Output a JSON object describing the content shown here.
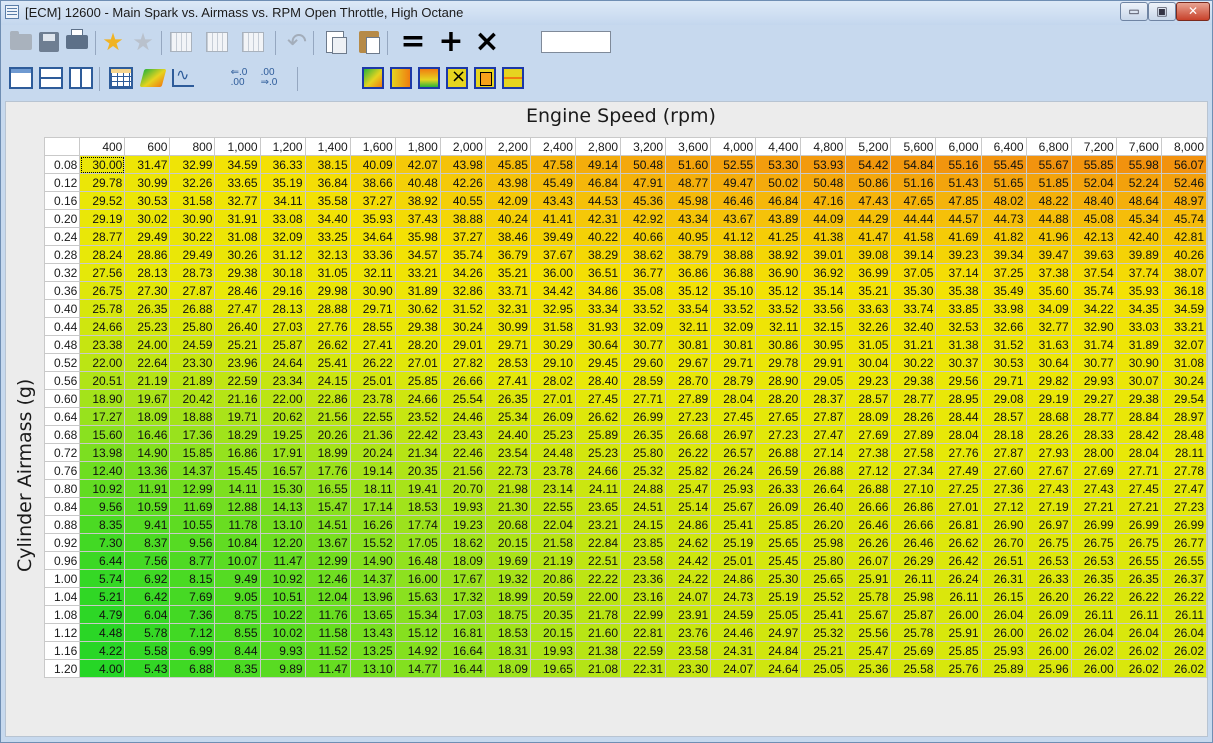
{
  "window": {
    "title": "[ECM] 12600 - Main Spark vs. Airmass vs. RPM Open Throttle, High Octane",
    "controls": {
      "minimize": "▭",
      "maximize": "▣",
      "close": "✕"
    }
  },
  "toolbar": {
    "row1_icons": [
      "open-folder-icon",
      "save-disk-icon",
      "print-icon",
      "add-favorite-star-icon",
      "remove-favorite-star-icon",
      "compare-grid-icon",
      "compare-grid-2-icon",
      "compare-grid-3-icon",
      "undo-icon",
      "copy-icon",
      "paste-icon",
      "set-equal-icon",
      "add-icon",
      "multiply-icon"
    ],
    "row2_icons": [
      "view-table-window-icon",
      "view-split-horizontal-icon",
      "view-split-vertical-icon",
      "table-view-icon",
      "3d-surface-icon",
      "2d-graph-icon",
      "decrease-decimals-icon",
      "increase-decimals-icon",
      "smooth-surface-icon",
      "smooth-columns-icon",
      "smooth-rows-icon",
      "interpolate-icon",
      "fill-selection-icon",
      "interpolate-rows-icon"
    ],
    "operation_value": "",
    "decrease_decimals_label": "⇐.0\n.00",
    "increase_decimals_label": ".00\n⇒.0"
  },
  "table": {
    "col_axis_title": "Engine Speed (rpm)",
    "row_axis_title": "Cylinder Airmass (g)",
    "columns": [
      "400",
      "600",
      "800",
      "1,000",
      "1,200",
      "1,400",
      "1,600",
      "1,800",
      "2,000",
      "2,200",
      "2,400",
      "2,800",
      "3,200",
      "3,600",
      "4,000",
      "4,400",
      "4,800",
      "5,200",
      "5,600",
      "6,000",
      "6,400",
      "6,800",
      "7,200",
      "7,600",
      "8,000"
    ],
    "rows": [
      {
        "airmass": "0.08",
        "values": [
          "30.00",
          "31.47",
          "32.99",
          "34.59",
          "36.33",
          "38.15",
          "40.09",
          "42.07",
          "43.98",
          "45.85",
          "47.58",
          "49.14",
          "50.48",
          "51.60",
          "52.55",
          "53.30",
          "53.93",
          "54.42",
          "54.84",
          "55.16",
          "55.45",
          "55.67",
          "55.85",
          "55.98",
          "56.07"
        ]
      },
      {
        "airmass": "0.12",
        "values": [
          "29.78",
          "30.99",
          "32.26",
          "33.65",
          "35.19",
          "36.84",
          "38.66",
          "40.48",
          "42.26",
          "43.98",
          "45.49",
          "46.84",
          "47.91",
          "48.77",
          "49.47",
          "50.02",
          "50.48",
          "50.86",
          "51.16",
          "51.43",
          "51.65",
          "51.85",
          "52.04",
          "52.24",
          "52.46"
        ]
      },
      {
        "airmass": "0.16",
        "values": [
          "29.52",
          "30.53",
          "31.58",
          "32.77",
          "34.11",
          "35.58",
          "37.27",
          "38.92",
          "40.55",
          "42.09",
          "43.43",
          "44.53",
          "45.36",
          "45.98",
          "46.46",
          "46.84",
          "47.16",
          "47.43",
          "47.65",
          "47.85",
          "48.02",
          "48.22",
          "48.40",
          "48.64",
          "48.97"
        ]
      },
      {
        "airmass": "0.20",
        "values": [
          "29.19",
          "30.02",
          "30.90",
          "31.91",
          "33.08",
          "34.40",
          "35.93",
          "37.43",
          "38.88",
          "40.24",
          "41.41",
          "42.31",
          "42.92",
          "43.34",
          "43.67",
          "43.89",
          "44.09",
          "44.29",
          "44.44",
          "44.57",
          "44.73",
          "44.88",
          "45.08",
          "45.34",
          "45.74"
        ]
      },
      {
        "airmass": "0.24",
        "values": [
          "28.77",
          "29.49",
          "30.22",
          "31.08",
          "32.09",
          "33.25",
          "34.64",
          "35.98",
          "37.27",
          "38.46",
          "39.49",
          "40.22",
          "40.66",
          "40.95",
          "41.12",
          "41.25",
          "41.38",
          "41.47",
          "41.58",
          "41.69",
          "41.82",
          "41.96",
          "42.13",
          "42.40",
          "42.81"
        ]
      },
      {
        "airmass": "0.28",
        "values": [
          "28.24",
          "28.86",
          "29.49",
          "30.26",
          "31.12",
          "32.13",
          "33.36",
          "34.57",
          "35.74",
          "36.79",
          "37.67",
          "38.29",
          "38.62",
          "38.79",
          "38.88",
          "38.92",
          "39.01",
          "39.08",
          "39.14",
          "39.23",
          "39.34",
          "39.47",
          "39.63",
          "39.89",
          "40.26"
        ]
      },
      {
        "airmass": "0.32",
        "values": [
          "27.56",
          "28.13",
          "28.73",
          "29.38",
          "30.18",
          "31.05",
          "32.11",
          "33.21",
          "34.26",
          "35.21",
          "36.00",
          "36.51",
          "36.77",
          "36.86",
          "36.88",
          "36.90",
          "36.92",
          "36.99",
          "37.05",
          "37.14",
          "37.25",
          "37.38",
          "37.54",
          "37.74",
          "38.07"
        ]
      },
      {
        "airmass": "0.36",
        "values": [
          "26.75",
          "27.30",
          "27.87",
          "28.46",
          "29.16",
          "29.98",
          "30.90",
          "31.89",
          "32.86",
          "33.71",
          "34.42",
          "34.86",
          "35.08",
          "35.12",
          "35.10",
          "35.12",
          "35.14",
          "35.21",
          "35.30",
          "35.38",
          "35.49",
          "35.60",
          "35.74",
          "35.93",
          "36.18"
        ]
      },
      {
        "airmass": "0.40",
        "values": [
          "25.78",
          "26.35",
          "26.88",
          "27.47",
          "28.13",
          "28.88",
          "29.71",
          "30.62",
          "31.52",
          "32.31",
          "32.95",
          "33.34",
          "33.52",
          "33.54",
          "33.52",
          "33.52",
          "33.56",
          "33.63",
          "33.74",
          "33.85",
          "33.98",
          "34.09",
          "34.22",
          "34.35",
          "34.59"
        ]
      },
      {
        "airmass": "0.44",
        "values": [
          "24.66",
          "25.23",
          "25.80",
          "26.40",
          "27.03",
          "27.76",
          "28.55",
          "29.38",
          "30.24",
          "30.99",
          "31.58",
          "31.93",
          "32.09",
          "32.11",
          "32.09",
          "32.11",
          "32.15",
          "32.26",
          "32.40",
          "32.53",
          "32.66",
          "32.77",
          "32.90",
          "33.03",
          "33.21"
        ]
      },
      {
        "airmass": "0.48",
        "values": [
          "23.38",
          "24.00",
          "24.59",
          "25.21",
          "25.87",
          "26.62",
          "27.41",
          "28.20",
          "29.01",
          "29.71",
          "30.29",
          "30.64",
          "30.77",
          "30.81",
          "30.81",
          "30.86",
          "30.95",
          "31.05",
          "31.21",
          "31.38",
          "31.52",
          "31.63",
          "31.74",
          "31.89",
          "32.07"
        ]
      },
      {
        "airmass": "0.52",
        "values": [
          "22.00",
          "22.64",
          "23.30",
          "23.96",
          "24.64",
          "25.41",
          "26.22",
          "27.01",
          "27.82",
          "28.53",
          "29.10",
          "29.45",
          "29.60",
          "29.67",
          "29.71",
          "29.78",
          "29.91",
          "30.04",
          "30.22",
          "30.37",
          "30.53",
          "30.64",
          "30.77",
          "30.90",
          "31.08"
        ]
      },
      {
        "airmass": "0.56",
        "values": [
          "20.51",
          "21.19",
          "21.89",
          "22.59",
          "23.34",
          "24.15",
          "25.01",
          "25.85",
          "26.66",
          "27.41",
          "28.02",
          "28.40",
          "28.59",
          "28.70",
          "28.79",
          "28.90",
          "29.05",
          "29.23",
          "29.38",
          "29.56",
          "29.71",
          "29.82",
          "29.93",
          "30.07",
          "30.24"
        ]
      },
      {
        "airmass": "0.60",
        "values": [
          "18.90",
          "19.67",
          "20.42",
          "21.16",
          "22.00",
          "22.86",
          "23.78",
          "24.66",
          "25.54",
          "26.35",
          "27.01",
          "27.45",
          "27.71",
          "27.89",
          "28.04",
          "28.20",
          "28.37",
          "28.57",
          "28.77",
          "28.95",
          "29.08",
          "29.19",
          "29.27",
          "29.38",
          "29.54"
        ]
      },
      {
        "airmass": "0.64",
        "values": [
          "17.27",
          "18.09",
          "18.88",
          "19.71",
          "20.62",
          "21.56",
          "22.55",
          "23.52",
          "24.46",
          "25.34",
          "26.09",
          "26.62",
          "26.99",
          "27.23",
          "27.45",
          "27.65",
          "27.87",
          "28.09",
          "28.26",
          "28.44",
          "28.57",
          "28.68",
          "28.77",
          "28.84",
          "28.97"
        ]
      },
      {
        "airmass": "0.68",
        "values": [
          "15.60",
          "16.46",
          "17.36",
          "18.29",
          "19.25",
          "20.26",
          "21.36",
          "22.42",
          "23.43",
          "24.40",
          "25.23",
          "25.89",
          "26.35",
          "26.68",
          "26.97",
          "27.23",
          "27.47",
          "27.69",
          "27.89",
          "28.04",
          "28.18",
          "28.26",
          "28.33",
          "28.42",
          "28.48"
        ]
      },
      {
        "airmass": "0.72",
        "values": [
          "13.98",
          "14.90",
          "15.85",
          "16.86",
          "17.91",
          "18.99",
          "20.24",
          "21.34",
          "22.46",
          "23.54",
          "24.48",
          "25.23",
          "25.80",
          "26.22",
          "26.57",
          "26.88",
          "27.14",
          "27.38",
          "27.58",
          "27.76",
          "27.87",
          "27.93",
          "28.00",
          "28.04",
          "28.11"
        ]
      },
      {
        "airmass": "0.76",
        "values": [
          "12.40",
          "13.36",
          "14.37",
          "15.45",
          "16.57",
          "17.76",
          "19.14",
          "20.35",
          "21.56",
          "22.73",
          "23.78",
          "24.66",
          "25.32",
          "25.82",
          "26.24",
          "26.59",
          "26.88",
          "27.12",
          "27.34",
          "27.49",
          "27.60",
          "27.67",
          "27.69",
          "27.71",
          "27.78"
        ]
      },
      {
        "airmass": "0.80",
        "values": [
          "10.92",
          "11.91",
          "12.99",
          "14.11",
          "15.30",
          "16.55",
          "18.11",
          "19.41",
          "20.70",
          "21.98",
          "23.14",
          "24.11",
          "24.88",
          "25.47",
          "25.93",
          "26.33",
          "26.64",
          "26.88",
          "27.10",
          "27.25",
          "27.36",
          "27.43",
          "27.43",
          "27.45",
          "27.47"
        ]
      },
      {
        "airmass": "0.84",
        "values": [
          "9.56",
          "10.59",
          "11.69",
          "12.88",
          "14.13",
          "15.47",
          "17.14",
          "18.53",
          "19.93",
          "21.30",
          "22.55",
          "23.65",
          "24.51",
          "25.14",
          "25.67",
          "26.09",
          "26.40",
          "26.66",
          "26.86",
          "27.01",
          "27.12",
          "27.19",
          "27.21",
          "27.21",
          "27.23"
        ]
      },
      {
        "airmass": "0.88",
        "values": [
          "8.35",
          "9.41",
          "10.55",
          "11.78",
          "13.10",
          "14.51",
          "16.26",
          "17.74",
          "19.23",
          "20.68",
          "22.04",
          "23.21",
          "24.15",
          "24.86",
          "25.41",
          "25.85",
          "26.20",
          "26.46",
          "26.66",
          "26.81",
          "26.90",
          "26.97",
          "26.99",
          "26.99",
          "26.99"
        ]
      },
      {
        "airmass": "0.92",
        "values": [
          "7.30",
          "8.37",
          "9.56",
          "10.84",
          "12.20",
          "13.67",
          "15.52",
          "17.05",
          "18.62",
          "20.15",
          "21.58",
          "22.84",
          "23.85",
          "24.62",
          "25.19",
          "25.65",
          "25.98",
          "26.26",
          "26.46",
          "26.62",
          "26.70",
          "26.75",
          "26.75",
          "26.75",
          "26.77"
        ]
      },
      {
        "airmass": "0.96",
        "values": [
          "6.44",
          "7.56",
          "8.77",
          "10.07",
          "11.47",
          "12.99",
          "14.90",
          "16.48",
          "18.09",
          "19.69",
          "21.19",
          "22.51",
          "23.58",
          "24.42",
          "25.01",
          "25.45",
          "25.80",
          "26.07",
          "26.29",
          "26.42",
          "26.51",
          "26.53",
          "26.53",
          "26.55",
          "26.55"
        ]
      },
      {
        "airmass": "1.00",
        "values": [
          "5.74",
          "6.92",
          "8.15",
          "9.49",
          "10.92",
          "12.46",
          "14.37",
          "16.00",
          "17.67",
          "19.32",
          "20.86",
          "22.22",
          "23.36",
          "24.22",
          "24.86",
          "25.30",
          "25.65",
          "25.91",
          "26.11",
          "26.24",
          "26.31",
          "26.33",
          "26.35",
          "26.35",
          "26.37"
        ]
      },
      {
        "airmass": "1.04",
        "values": [
          "5.21",
          "6.42",
          "7.69",
          "9.05",
          "10.51",
          "12.04",
          "13.96",
          "15.63",
          "17.32",
          "18.99",
          "20.59",
          "22.00",
          "23.16",
          "24.07",
          "24.73",
          "25.19",
          "25.52",
          "25.78",
          "25.98",
          "26.11",
          "26.15",
          "26.20",
          "26.22",
          "26.22",
          "26.22"
        ]
      },
      {
        "airmass": "1.08",
        "values": [
          "4.79",
          "6.04",
          "7.36",
          "8.75",
          "10.22",
          "11.76",
          "13.65",
          "15.34",
          "17.03",
          "18.75",
          "20.35",
          "21.78",
          "22.99",
          "23.91",
          "24.59",
          "25.05",
          "25.41",
          "25.67",
          "25.87",
          "26.00",
          "26.04",
          "26.09",
          "26.11",
          "26.11",
          "26.11"
        ]
      },
      {
        "airmass": "1.12",
        "values": [
          "4.48",
          "5.78",
          "7.12",
          "8.55",
          "10.02",
          "11.58",
          "13.43",
          "15.12",
          "16.81",
          "18.53",
          "20.15",
          "21.60",
          "22.81",
          "23.76",
          "24.46",
          "24.97",
          "25.32",
          "25.56",
          "25.78",
          "25.91",
          "26.00",
          "26.02",
          "26.04",
          "26.04",
          "26.04"
        ]
      },
      {
        "airmass": "1.16",
        "values": [
          "4.22",
          "5.58",
          "6.99",
          "8.44",
          "9.93",
          "11.52",
          "13.25",
          "14.92",
          "16.64",
          "18.31",
          "19.93",
          "21.38",
          "22.59",
          "23.58",
          "24.31",
          "24.84",
          "25.21",
          "25.47",
          "25.69",
          "25.85",
          "25.93",
          "26.00",
          "26.02",
          "26.02",
          "26.02"
        ]
      },
      {
        "airmass": "1.20",
        "values": [
          "4.00",
          "5.43",
          "6.88",
          "8.35",
          "9.89",
          "11.47",
          "13.10",
          "14.77",
          "16.44",
          "18.09",
          "19.65",
          "21.08",
          "22.31",
          "23.30",
          "24.07",
          "24.64",
          "25.05",
          "25.36",
          "25.58",
          "25.76",
          "25.89",
          "25.96",
          "26.00",
          "26.02",
          "26.02"
        ]
      }
    ]
  }
}
